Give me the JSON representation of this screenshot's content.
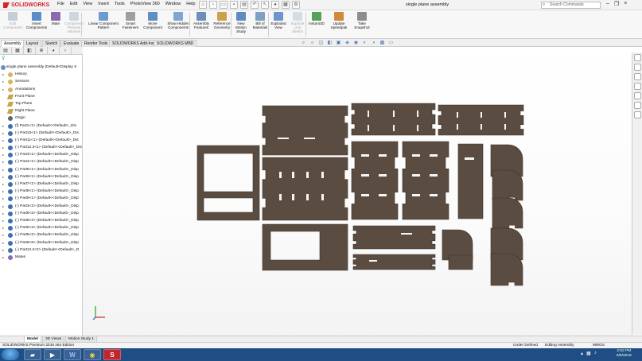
{
  "app": {
    "brand": "SOLIDWORKS",
    "document_title": "single plane assembly",
    "search_placeholder": "Search Commands"
  },
  "menu": [
    "File",
    "Edit",
    "View",
    "Insert",
    "Tools",
    "PhotoView 360",
    "Window",
    "Help"
  ],
  "commands": [
    {
      "label": "Edit Component",
      "disabled": true,
      "icon": "edit-component-icon",
      "color": "#7a8fa8"
    },
    {
      "label": "Insert Components",
      "disabled": false,
      "icon": "insert-components-icon",
      "color": "#5a8cc8"
    },
    {
      "label": "Mate",
      "disabled": false,
      "icon": "mate-icon",
      "color": "#8b6bb0"
    },
    {
      "label": "Component Preview Window",
      "disabled": true,
      "icon": "preview-window-icon",
      "color": "#8fa6bf"
    },
    {
      "label": "Linear Component Pattern",
      "disabled": false,
      "icon": "linear-pattern-icon",
      "color": "#6a9cd0"
    },
    {
      "label": "Smart Fasteners",
      "disabled": false,
      "icon": "smart-fasteners-icon",
      "color": "#9aa0a6"
    },
    {
      "label": "Move Component",
      "disabled": false,
      "icon": "move-component-icon",
      "color": "#5f90c4"
    },
    {
      "label": "Show Hidden Components",
      "disabled": false,
      "icon": "show-hidden-icon",
      "color": "#7ea6d3"
    },
    {
      "label": "Assembly Features",
      "disabled": false,
      "icon": "assembly-features-icon",
      "color": "#6c8fb9"
    },
    {
      "label": "Reference Geometry",
      "disabled": false,
      "icon": "reference-geometry-icon",
      "color": "#c9a24a"
    },
    {
      "label": "New Motion Study",
      "disabled": false,
      "icon": "motion-study-icon",
      "color": "#5e8bc0"
    },
    {
      "label": "Bill of Materials",
      "disabled": false,
      "icon": "bom-icon",
      "color": "#7f9fc5"
    },
    {
      "label": "Exploded View",
      "disabled": false,
      "icon": "exploded-view-icon",
      "color": "#6d96cb"
    },
    {
      "label": "Explode Line Sketch",
      "disabled": true,
      "icon": "explode-line-icon",
      "color": "#9fb3c9"
    },
    {
      "label": "Instant3D",
      "disabled": false,
      "icon": "instant3d-icon",
      "color": "#58a05a"
    },
    {
      "label": "Update Speedpak",
      "disabled": false,
      "icon": "speedpak-icon",
      "color": "#d08a3a"
    },
    {
      "label": "Take Snapshot",
      "disabled": false,
      "icon": "snapshot-icon",
      "color": "#8d8d8d"
    }
  ],
  "command_tabs": [
    "Assembly",
    "Layout",
    "Sketch",
    "Evaluate",
    "Render Tools",
    "SOLIDWORKS Add-Ins",
    "SOLIDWORKS MBD"
  ],
  "tree": {
    "root": "single plane assembly  (Default<Display S",
    "items": [
      {
        "label": "History",
        "kind": "folder"
      },
      {
        "label": "Sensors",
        "kind": "folder"
      },
      {
        "label": "Annotations",
        "kind": "folder"
      },
      {
        "label": "Front Plane",
        "kind": "plane"
      },
      {
        "label": "Top Plane",
        "kind": "plane"
      },
      {
        "label": "Right Plane",
        "kind": "plane"
      },
      {
        "label": "Origin",
        "kind": "origin"
      },
      {
        "label": "(f) Part1<1> (Default<<Default>_Dis",
        "kind": "part"
      },
      {
        "label": "(-) Part10<1> (Default<<Default>_Dis",
        "kind": "part"
      },
      {
        "label": "(-) Part11<1> (Default<<Default>_Dis",
        "kind": "part"
      },
      {
        "label": "(-) Part12.2<1> (Default<<Default>_Dis",
        "kind": "part"
      },
      {
        "label": "(-) Part3<1> (Default<<Default>_Disp",
        "kind": "part"
      },
      {
        "label": "(-) Part4<1> (Default<<Default>_Disp",
        "kind": "part"
      },
      {
        "label": "(-) Part5<1> (Default<<Default>_Disp",
        "kind": "part"
      },
      {
        "label": "(-) Part6<1> (Default<<Default>_Disp",
        "kind": "part"
      },
      {
        "label": "(-) Part7<1> (Default<<Default>_Disp",
        "kind": "part"
      },
      {
        "label": "(-) Part8<1> (Default<<Default>_Disp",
        "kind": "part"
      },
      {
        "label": "(-) Part9<1> (Default<<Default>_Disp",
        "kind": "part"
      },
      {
        "label": "(-) Part3<2> (Default<<Default>_Disp",
        "kind": "part"
      },
      {
        "label": "(-) Part6<2> (Default<<Default>_Disp",
        "kind": "part"
      },
      {
        "label": "(-) Part6<4> (Default<<Default>_Disp",
        "kind": "part"
      },
      {
        "label": "(-) Part6<3> (Default<<Default>_Disp",
        "kind": "part"
      },
      {
        "label": "(-) Part5<2> (Default<<Default>_Disp",
        "kind": "part"
      },
      {
        "label": "(-) Part6<6> (Default<<Default>_Disp",
        "kind": "part"
      },
      {
        "label": "(-) Part12.2<2> (Default<<Default>_D",
        "kind": "part"
      },
      {
        "label": "Mates",
        "kind": "mates"
      }
    ]
  },
  "bottom_tabs": [
    "Model",
    "3D Views",
    "Motion Study 1"
  ],
  "status": {
    "edition": "SOLIDWORKS Premium 2016 x64 Edition",
    "definition": "Under Defined",
    "mode": "Editing Assembly",
    "units": "MMGS"
  },
  "taskbar": {
    "time": "2:52 PM",
    "date": "5/6/2019",
    "apps": [
      "explorer",
      "media-player",
      "word",
      "chrome",
      "solidworks"
    ]
  },
  "colors": {
    "wood": "#5a4c40",
    "wood_edge": "#3a3028",
    "accent": "#d8232a",
    "taskbar": "#1f4e84"
  }
}
